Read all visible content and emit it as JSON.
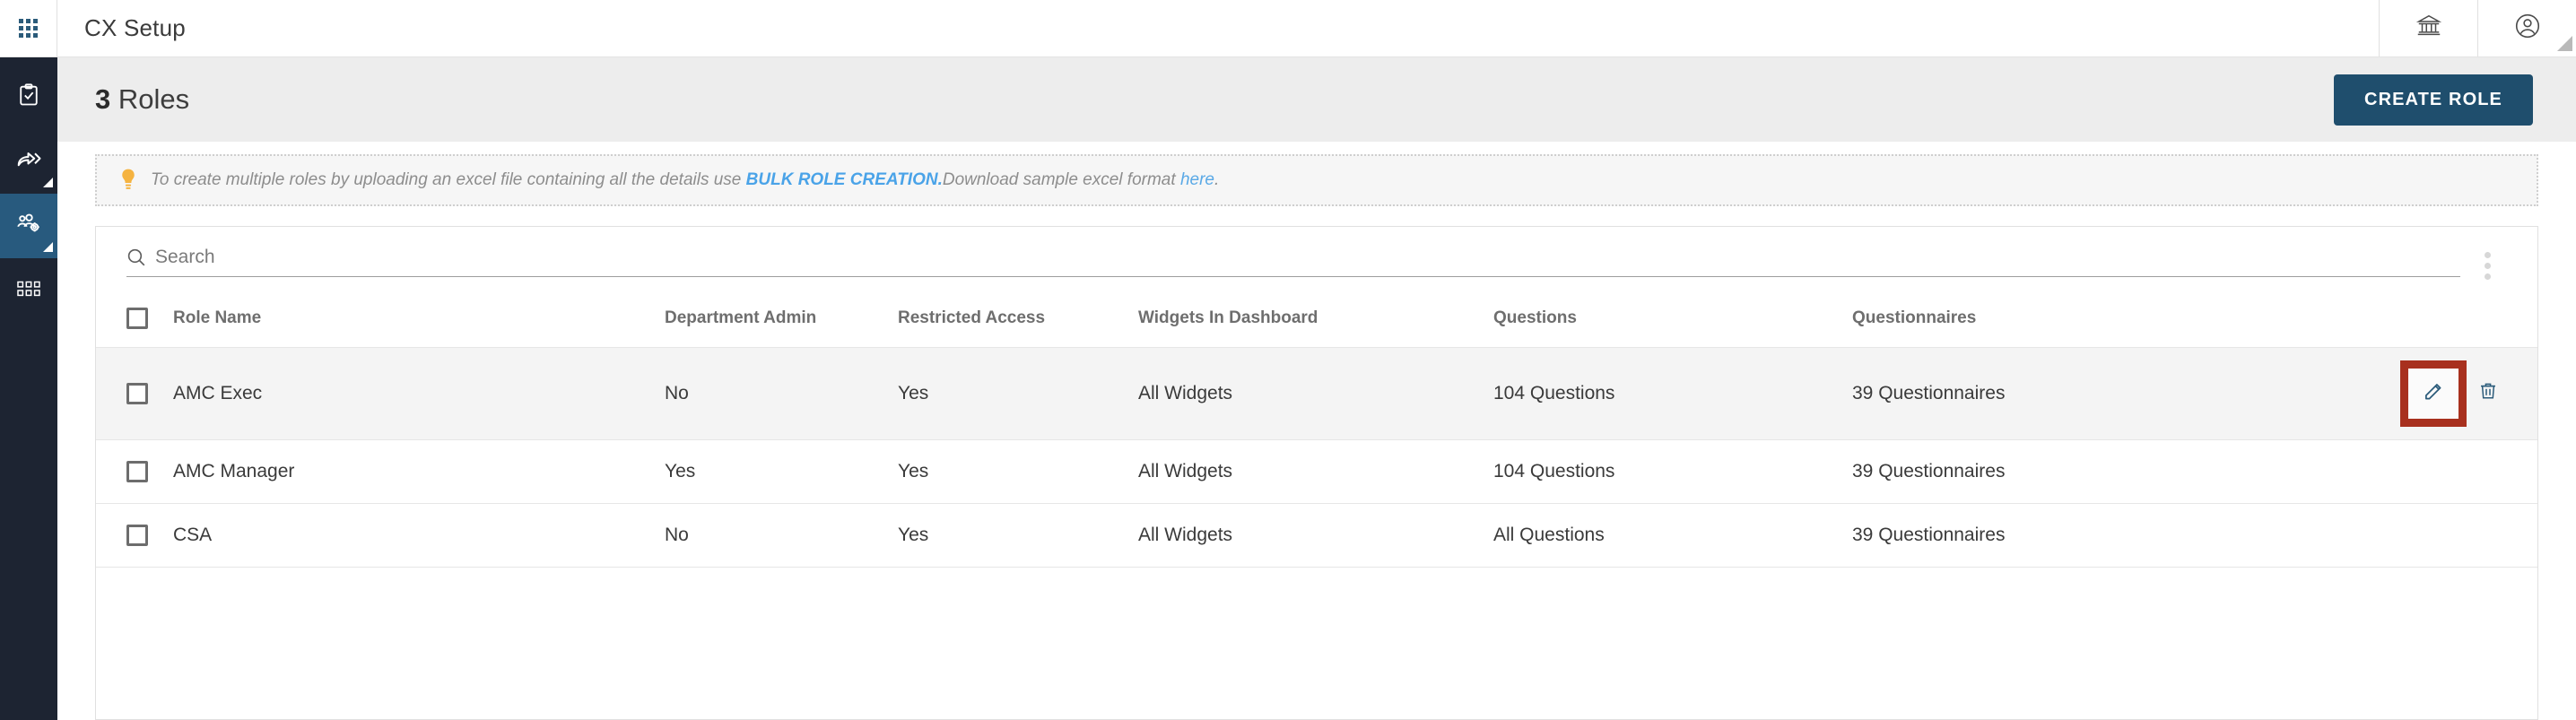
{
  "topbar": {
    "apps_icon": "apps-grid-icon",
    "title": "CX Setup",
    "actions": [
      {
        "icon": "bank-institution-icon",
        "name": "institution-button"
      },
      {
        "icon": "user-account-icon",
        "name": "account-button"
      }
    ]
  },
  "rail": {
    "items": [
      {
        "icon": "clipboard-check-icon",
        "name": "sidebar-item-surveys",
        "active": false,
        "sub": false
      },
      {
        "icon": "share-arrow-icon",
        "name": "sidebar-item-distribute",
        "active": false,
        "sub": true
      },
      {
        "icon": "users-gear-icon",
        "name": "sidebar-item-user-management",
        "active": true,
        "sub": true
      },
      {
        "icon": "grid-modules-icon",
        "name": "sidebar-item-modules",
        "active": false,
        "sub": false
      }
    ]
  },
  "page": {
    "count": "3",
    "title_suffix": " Roles",
    "create_button": "CREATE ROLE"
  },
  "banner": {
    "icon": "lightbulb-icon",
    "text_before": "To create multiple roles by uploading an excel file containing all the details use ",
    "bulk_link": "BULK ROLE CREATION.",
    "text_middle": "Download sample excel format ",
    "here_link": "here",
    "text_end": "."
  },
  "search": {
    "icon": "search-icon",
    "placeholder": "Search",
    "value": "",
    "kebab": "more-options-icon"
  },
  "table": {
    "columns": [
      "Role Name",
      "Department Admin",
      "Restricted Access",
      "Widgets In Dashboard",
      "Questions",
      "Questionnaires"
    ],
    "rows": [
      {
        "role_name": "AMC Exec",
        "department_admin": "No",
        "restricted_access": "Yes",
        "widgets_in_dashboard": "All Widgets",
        "questions": "104 Questions",
        "questionnaires": "39 Questionnaires",
        "highlighted": true
      },
      {
        "role_name": "AMC Manager",
        "department_admin": "Yes",
        "restricted_access": "Yes",
        "widgets_in_dashboard": "All Widgets",
        "questions": "104 Questions",
        "questionnaires": "39 Questionnaires",
        "highlighted": false
      },
      {
        "role_name": "CSA",
        "department_admin": "No",
        "restricted_access": "Yes",
        "widgets_in_dashboard": "All Widgets",
        "questions": "All Questions",
        "questionnaires": "39 Questionnaires",
        "highlighted": false
      }
    ],
    "row_actions": {
      "edit": "edit-pencil-icon",
      "delete": "delete-trash-icon"
    }
  },
  "colors": {
    "rail_bg": "#1d2432",
    "rail_active": "#285a7e",
    "accent": "#1f4e6d",
    "link": "#4aa3e8",
    "bulb": "#f5b340",
    "highlight_box": "#a8301e",
    "page_head_bg": "#ededed"
  }
}
